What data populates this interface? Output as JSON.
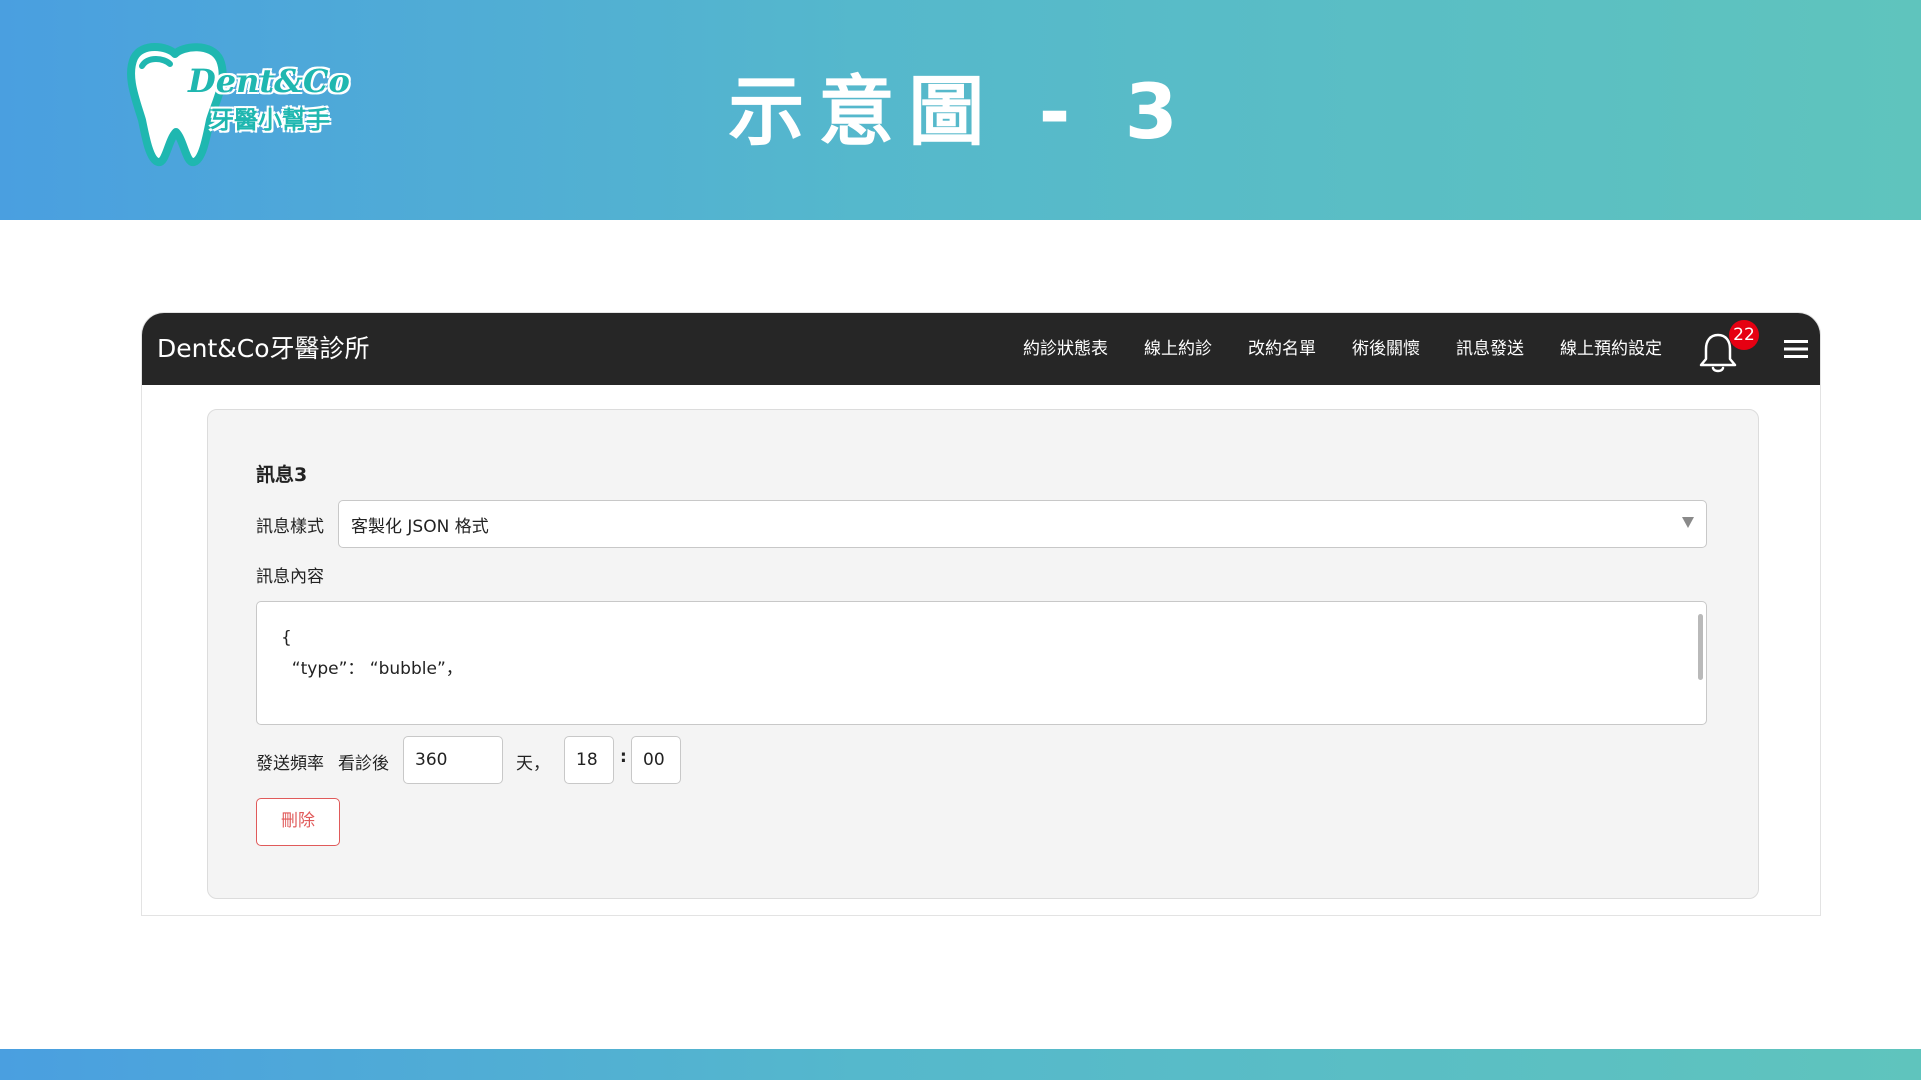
{
  "slide": {
    "title": "示意圖 - 3",
    "logo_word": "Dent&Co",
    "logo_sub": "牙醫小幫手"
  },
  "navbar": {
    "brand": "Dent&Co牙醫診所",
    "links": [
      "約診狀態表",
      "線上約診",
      "改約名單",
      "術後關懷",
      "訊息發送",
      "線上預約設定"
    ],
    "notification_count": "22"
  },
  "message": {
    "title": "訊息3",
    "style_label": "訊息樣式",
    "style_value": "客製化 JSON 格式",
    "content_label": "訊息內容",
    "content_line1": "{",
    "content_line2": "  “type”： “bubble”，",
    "frequency_label": "發送頻率",
    "after_visit_label": "看診後",
    "days_value": "360",
    "days_unit": "天，",
    "hour_value": "18",
    "time_separator": ":",
    "minute_value": "00",
    "delete_label": "刪除"
  },
  "colors": {
    "header_gradient_start": "#4a9fe0",
    "header_gradient_end": "#5fc4bd",
    "navbar_bg": "#262626",
    "badge": "#e60012",
    "delete": "#e05a5a",
    "logo": "#1fb7b0"
  }
}
